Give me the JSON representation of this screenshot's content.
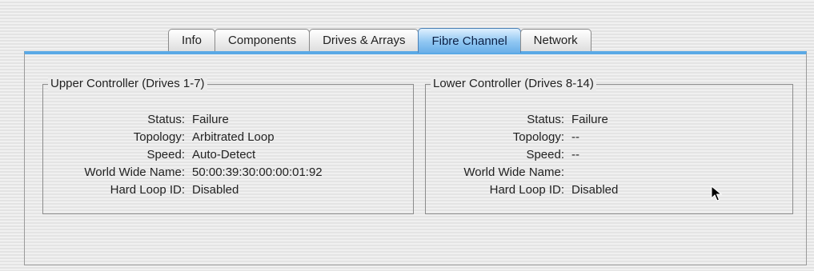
{
  "tabs": [
    {
      "label": "Info",
      "active": false
    },
    {
      "label": "Components",
      "active": false
    },
    {
      "label": "Drives & Arrays",
      "active": false
    },
    {
      "label": "Fibre Channel",
      "active": true
    },
    {
      "label": "Network",
      "active": false
    }
  ],
  "upper": {
    "title": "Upper Controller (Drives 1-7)",
    "rows": [
      {
        "label": "Status:",
        "value": "Failure"
      },
      {
        "label": "Topology:",
        "value": "Arbitrated Loop"
      },
      {
        "label": "Speed:",
        "value": "Auto-Detect"
      },
      {
        "label": "World Wide Name:",
        "value": "50:00:39:30:00:00:01:92"
      },
      {
        "label": "Hard Loop ID:",
        "value": "Disabled"
      }
    ]
  },
  "lower": {
    "title": "Lower Controller (Drives 8-14)",
    "rows": [
      {
        "label": "Status:",
        "value": "Failure"
      },
      {
        "label": "Topology:",
        "value": "--"
      },
      {
        "label": "Speed:",
        "value": "--"
      },
      {
        "label": "World Wide Name:",
        "value": ""
      },
      {
        "label": "Hard Loop ID:",
        "value": "Disabled"
      }
    ]
  },
  "colors": {
    "accent": "#5aa9e6",
    "active_tab": "#8fc6f2"
  },
  "icons": {
    "cursor": "arrow-cursor-icon"
  }
}
